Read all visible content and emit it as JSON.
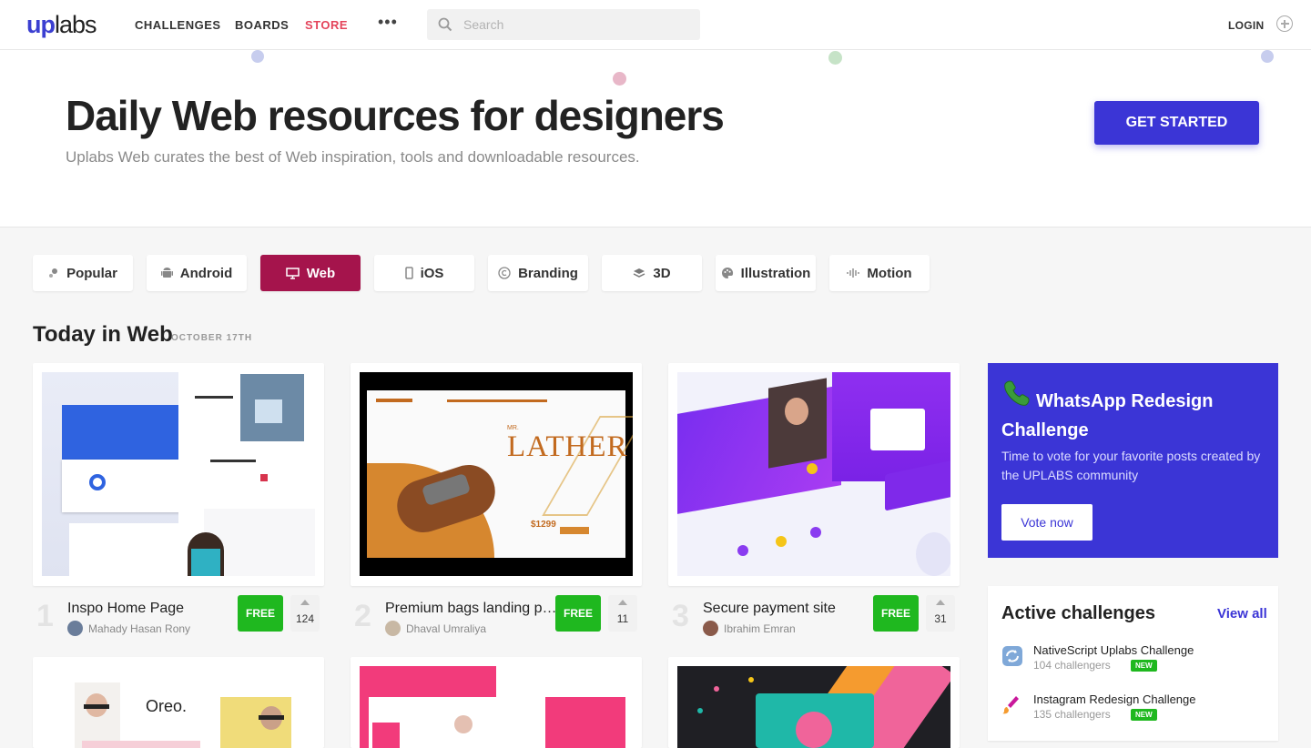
{
  "logo": {
    "up": "UP",
    "labs": "labs"
  },
  "nav": [
    {
      "label": "CHALLENGES"
    },
    {
      "label": "BOARDS"
    },
    {
      "label": "STORE"
    }
  ],
  "more_label": "•••",
  "search": {
    "placeholder": "Search"
  },
  "login_label": "LOGIN",
  "hero": {
    "title": "Daily Web resources for designers",
    "subtitle": "Uplabs Web curates the best of Web inspiration, tools and downloadable resources.",
    "cta": "GET STARTED"
  },
  "categories": [
    {
      "label": "Popular",
      "icon": "popular-icon"
    },
    {
      "label": "Android",
      "icon": "android-icon"
    },
    {
      "label": "Web",
      "icon": "monitor-icon",
      "active": true
    },
    {
      "label": "iOS",
      "icon": "phone-icon"
    },
    {
      "label": "Branding",
      "icon": "copyright-icon"
    },
    {
      "label": "3D",
      "icon": "layers-icon"
    },
    {
      "label": "Illustration",
      "icon": "palette-icon"
    },
    {
      "label": "Motion",
      "icon": "waveform-icon"
    }
  ],
  "section": {
    "title": "Today in Web",
    "date": "OCTOBER 17TH"
  },
  "posts": [
    {
      "rank": "1",
      "title": "Inspo Home Page",
      "author": "Mahady Hasan Rony",
      "price": "FREE",
      "votes": "124"
    },
    {
      "rank": "2",
      "title": "Premium bags landing page",
      "author": "Dhaval Umraliya",
      "price": "FREE",
      "votes": "11"
    },
    {
      "rank": "3",
      "title": "Secure payment site",
      "author": "Ibrahim Emran",
      "price": "FREE",
      "votes": "31"
    }
  ],
  "thumb_text": {
    "lather_mr": "MR.",
    "lather": "LATHER",
    "price": "$1299",
    "oreo": "Oreo."
  },
  "promo": {
    "title": "WhatsApp Redesign Challenge",
    "description": "Time to vote for your favorite posts created by the UPLABS community",
    "button": "Vote now"
  },
  "active_challenges": {
    "title": "Active challenges",
    "view_all": "View all",
    "items": [
      {
        "name": "NativeScript Uplabs Challenge",
        "count": "104 challengers",
        "badge": "NEW"
      },
      {
        "name": "Instagram Redesign Challenge",
        "count": "135 challengers",
        "badge": "NEW"
      }
    ]
  },
  "colors": {
    "accent": "#3b35d6",
    "web_active": "#a5144c",
    "free_green": "#1fb81f",
    "store_red": "#e4445b"
  }
}
